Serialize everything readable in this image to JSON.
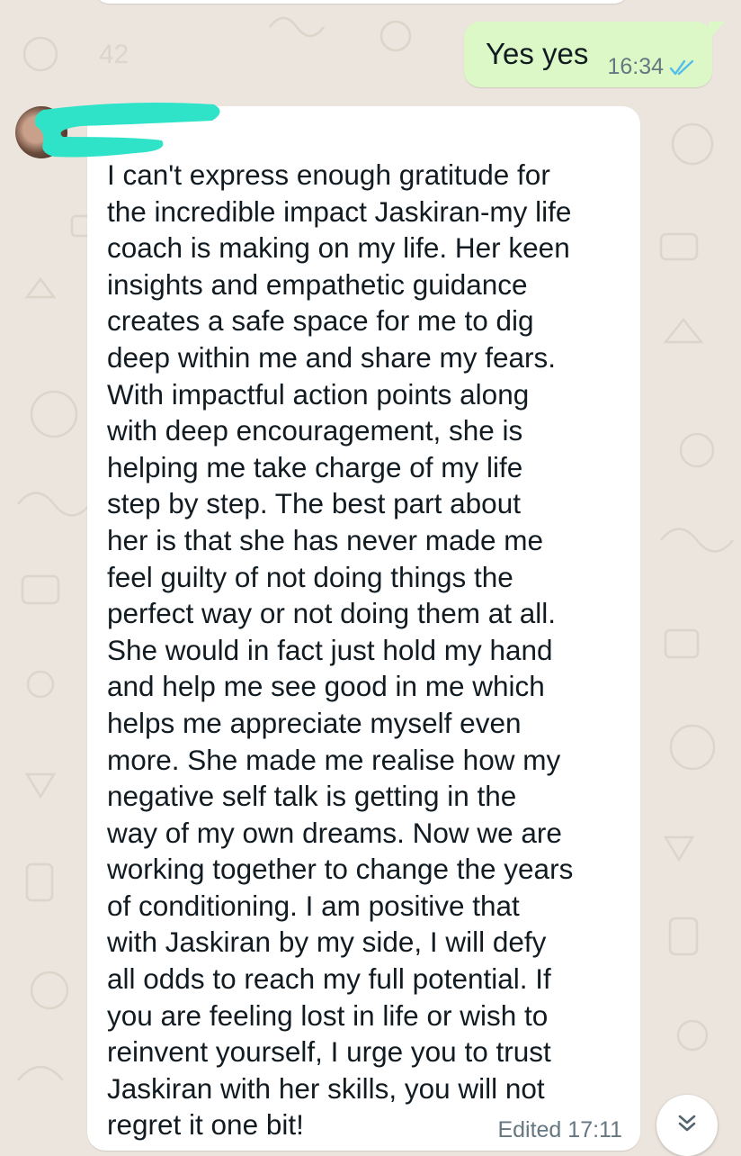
{
  "colors": {
    "wallpaper": "#ece5dd",
    "outgoing_bubble": "#dcf8c6",
    "incoming_bubble": "#ffffff",
    "read_ticks": "#53bdeb",
    "redaction": "#2fe3c8",
    "meta_text": "#667781"
  },
  "messages": {
    "outgoing": {
      "text": "Yes yes",
      "time": "16:34",
      "status_icon": "double-check-read-icon"
    },
    "incoming": {
      "sender_avatar_icon": "avatar",
      "sender_name_redacted": true,
      "text": "I can't express enough gratitude for\nthe incredible impact Jaskiran-my life\ncoach is making on my life. Her keen\ninsights and empathetic guidance\ncreates a safe space for me to dig\ndeep within me and share my fears.\nWith impactful action points along\nwith deep encouragement, she is\nhelping me take charge of my life\nstep by step. The best part about\nher is that she has never made me\nfeel guilty of not doing things the\nperfect way or not doing them at all.\nShe would in fact just hold my hand\nand help me see good in me which\nhelps me appreciate myself even\nmore. She made me realise how my\nnegative self talk is getting in the\nway of my own dreams. Now we are\nworking together to change the years\nof conditioning. I am positive that\nwith Jaskiran by my side, I will defy\nall odds to reach my full potential. If\nyou are feeling lost in life or wish to\nreinvent yourself, I urge you to trust\nJaskiran with her skills, you will not\nregret it one bit!",
      "meta": "Edited 17:11"
    }
  },
  "controls": {
    "scroll_to_bottom_icon": "double-chevron-down-icon"
  }
}
